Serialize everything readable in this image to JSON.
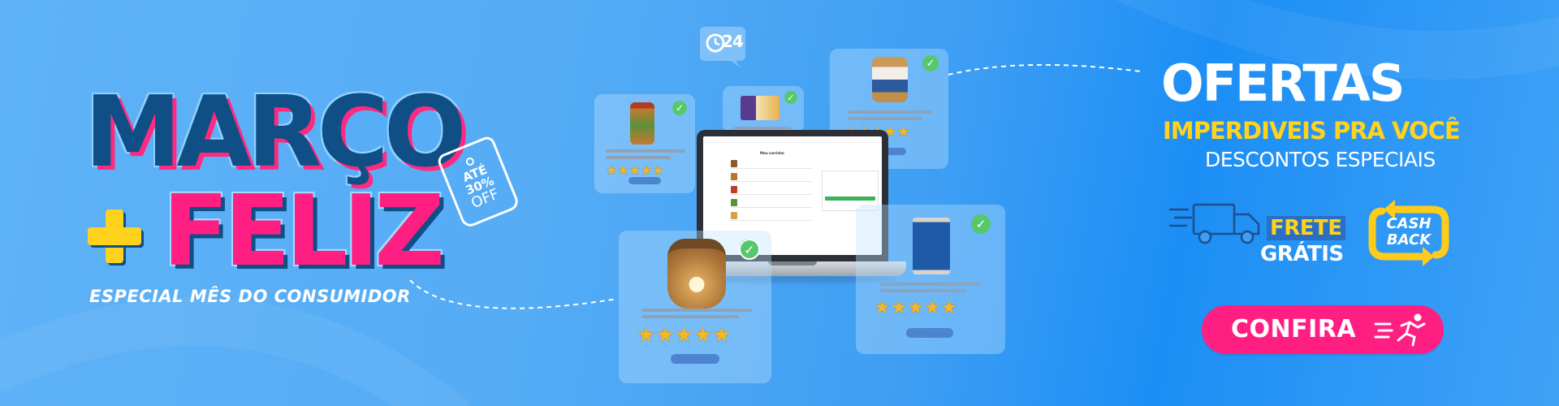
{
  "banner": {
    "headline_line1": "MARÇO",
    "headline_line2": "FELIZ",
    "subtitle": "ESPECIAL MÊS DO CONSUMIDOR",
    "discount_tag": {
      "line1": "ATÉ",
      "line2": "30%",
      "line3": "OFF"
    },
    "delivery_badge": "24"
  },
  "offers": {
    "title": "OFERTAS",
    "subtitle": "IMPERDIVEIS PRA VOCÊ",
    "tagline": "DESCONTOS ESPECIAIS",
    "shipping_line1": "FRETE",
    "shipping_line2": "GRÁTIS",
    "cashback_line1": "CASH",
    "cashback_line2": "BACK",
    "cta_label": "CONFIRA"
  },
  "laptop_screen": {
    "title": "Meu carrinho"
  },
  "product_cards": [
    {
      "name": "product-card-spice-jar",
      "rating": 5
    },
    {
      "name": "product-card-box",
      "rating": 5
    },
    {
      "name": "product-card-cream-jar",
      "rating": 5
    },
    {
      "name": "product-card-nuts-jar",
      "rating": 5
    },
    {
      "name": "product-card-tin",
      "rating": 5
    }
  ],
  "colors": {
    "background": "#4ea8f5",
    "headline_navy": "#0f4f86",
    "headline_pink": "#ff1f82",
    "accent_yellow": "#ffd21e",
    "cta_pink": "#ff1f82",
    "check_green": "#56c86b",
    "star_gold": "#f4b728"
  },
  "icons": [
    "plus-icon",
    "price-tag-icon",
    "clock-24-icon",
    "check-icon",
    "star-icon",
    "delivery-truck-icon",
    "cashback-arrows-icon",
    "running-person-icon"
  ]
}
